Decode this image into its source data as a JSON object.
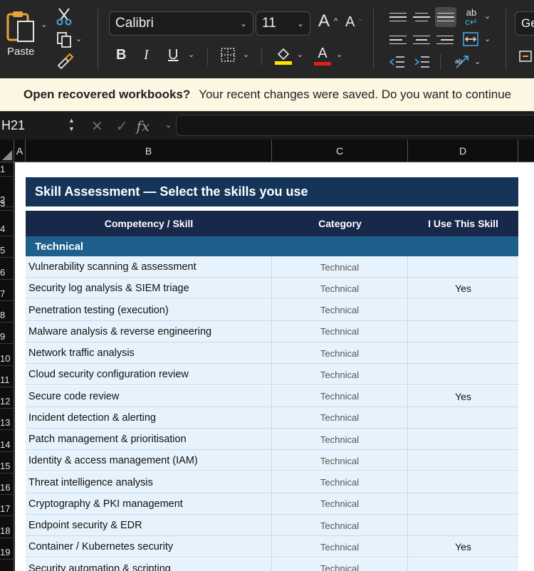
{
  "ribbon": {
    "paste_label": "Paste",
    "font_name": "Calibri",
    "font_size": "11",
    "bold": "B",
    "italic": "I",
    "underline": "U",
    "grow_font": "A",
    "shrink_font": "A",
    "font_color_glyph": "A",
    "next_group_label": "Ge",
    "wrap_glyph": "ab",
    "icons": [
      "clipboard-icon",
      "scissors-icon",
      "copy-icon",
      "format-painter-icon",
      "borders-icon",
      "fill-color-icon",
      "font-color-icon",
      "align-icon",
      "wrap-text-icon",
      "merge-icon",
      "orientation-icon",
      "cell-styles-icon"
    ],
    "fill_color": "#ffe500",
    "font_color": "#e0201c"
  },
  "message_bar": {
    "title": "Open recovered workbooks?",
    "text": "Your recent changes were saved. Do you want to continue"
  },
  "formula_bar": {
    "name_box": "H21",
    "cancel": "✕",
    "enter": "✓",
    "fx": "fx",
    "formula": ""
  },
  "columns": [
    "A",
    "B",
    "C",
    "D"
  ],
  "rows": [
    "1",
    "2",
    "3",
    "4",
    "5",
    "6",
    "7",
    "8",
    "9",
    "10",
    "11",
    "12",
    "13",
    "14",
    "15",
    "16",
    "17",
    "18",
    "19"
  ],
  "sheet": {
    "title": "Skill Assessment — Select the skills you use",
    "headers": {
      "skill": "Competency / Skill",
      "category": "Category",
      "use": "I Use This Skill"
    },
    "section": "Technical",
    "items": [
      {
        "skill": "Vulnerability scanning & assessment",
        "category": "Technical",
        "use": ""
      },
      {
        "skill": "Security log analysis & SIEM triage",
        "category": "Technical",
        "use": "Yes"
      },
      {
        "skill": "Penetration testing (execution)",
        "category": "Technical",
        "use": ""
      },
      {
        "skill": "Malware analysis & reverse engineering",
        "category": "Technical",
        "use": ""
      },
      {
        "skill": "Network traffic analysis",
        "category": "Technical",
        "use": ""
      },
      {
        "skill": "Cloud security configuration review",
        "category": "Technical",
        "use": ""
      },
      {
        "skill": "Secure code review",
        "category": "Technical",
        "use": "Yes"
      },
      {
        "skill": "Incident detection & alerting",
        "category": "Technical",
        "use": ""
      },
      {
        "skill": "Patch management & prioritisation",
        "category": "Technical",
        "use": ""
      },
      {
        "skill": "Identity & access management (IAM)",
        "category": "Technical",
        "use": ""
      },
      {
        "skill": "Threat intelligence analysis",
        "category": "Technical",
        "use": ""
      },
      {
        "skill": "Cryptography & PKI management",
        "category": "Technical",
        "use": ""
      },
      {
        "skill": "Endpoint security & EDR",
        "category": "Technical",
        "use": ""
      },
      {
        "skill": "Container / Kubernetes security",
        "category": "Technical",
        "use": "Yes"
      },
      {
        "skill": "Security automation & scripting",
        "category": "Technical",
        "use": ""
      }
    ]
  }
}
